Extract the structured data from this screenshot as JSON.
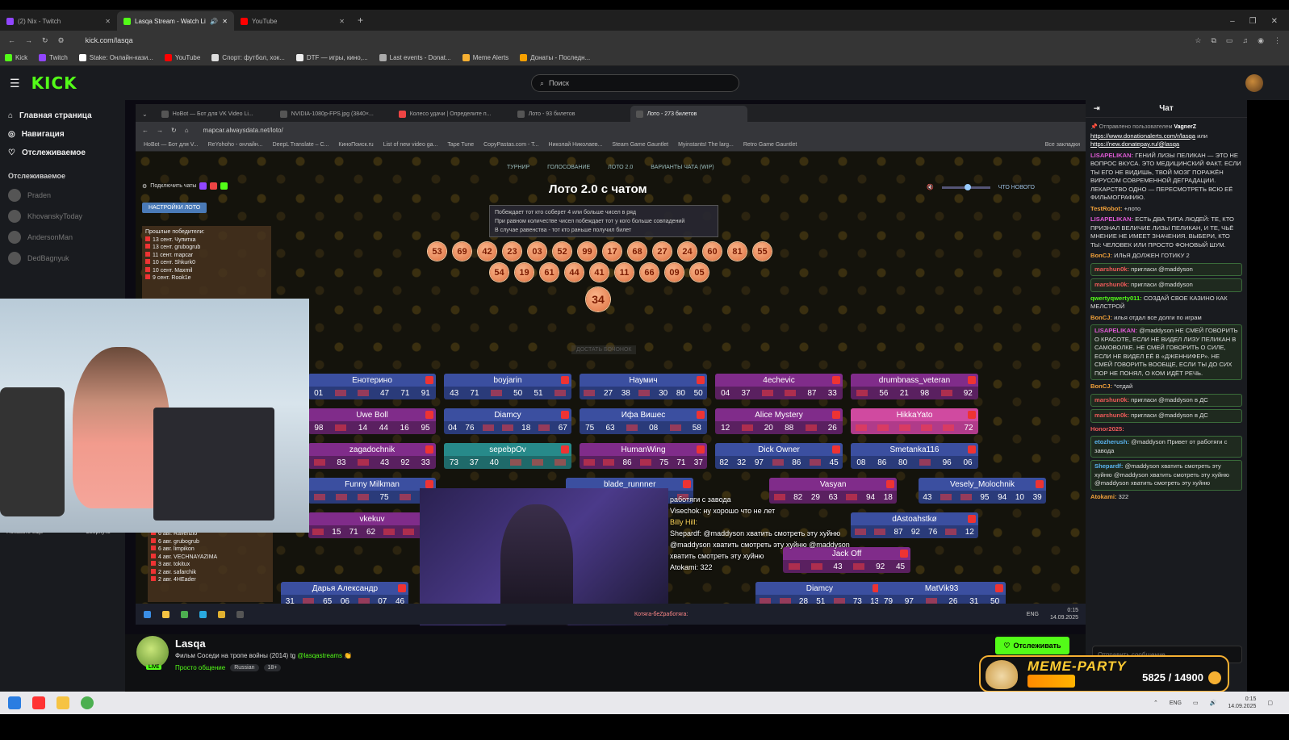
{
  "browser": {
    "tabs": [
      {
        "label": "(2) Nix - Twitch",
        "color": "#9146ff"
      },
      {
        "label": "Lasqa Stream - Watch Live",
        "color": "#53fc18"
      },
      {
        "label": "YouTube",
        "color": "#ff0000"
      }
    ],
    "new_tab": "+",
    "url": "kick.com/lasqa",
    "bookmarks": [
      "Kick",
      "Twitch",
      "Stake: Онлайн-кази...",
      "YouTube",
      "Спорт: футбол, хок...",
      "DTF — игры, кино,...",
      "Last events - Donat...",
      "Meme Alerts",
      "Донаты - Последн..."
    ]
  },
  "kick": {
    "logo": "KICK",
    "search_placeholder": "Поиск",
    "nav": [
      "Главная страница",
      "Навигация",
      "Отслеживаемое"
    ],
    "following_header": "Отслеживаемое",
    "following": [
      "Praden",
      "KhovanskyToday",
      "AndersonMan",
      "DedBagnyuk"
    ],
    "show_more": "Показать ещё",
    "collapse": "Свернуть"
  },
  "inner_browser": {
    "tabs": [
      "HoBot — Бот для VK Video Li...",
      "NVIDIA-1080p-FPS.jpg (3840×...",
      "Колесо удачи | Определите п...",
      "Лото - 93 билетов",
      "Лото - 273 билетов"
    ],
    "url": "mapcar.alwaysdata.net/loto/",
    "bookmarks": [
      "HoBot — Бот для V...",
      "ReYohoho - онлайн...",
      "DeepL Translate – C...",
      "КиноПоиск.ru",
      "List of new video ga...",
      "Tape Tune",
      "CopyPastas.com - T...",
      "Николай Николаев...",
      "Steam Game Gauntlet",
      "Myinstants! The larg...",
      "Retro Game Gauntlet"
    ],
    "all_bookmarks": "Все закладки"
  },
  "lotto": {
    "links": [
      "ТУРНИР",
      "ГОЛОСОВАНИЕ",
      "ЛОТО 2.0",
      "ВАРИАНТЫ ЧАТА (WIP)"
    ],
    "title": "Лото 2.0 с чатом",
    "rules": [
      "Побеждает тот кто соберет 4 или больше чисел в ряд",
      "При равном количестве чисел побеждает тот у кого больше совпадений",
      "В случае равенства - тот кто раньше получил билет"
    ],
    "whats_new": "ЧТО НОВОГО",
    "connect_chats": "Подключить чаты",
    "settings_btn": "НАСТРОЙКИ ЛОТО",
    "draw_btn": "ДОСТАТЬ БОЧОНОК",
    "winners_title": "Прошлые победители:",
    "winners": [
      "13 сент. Чупитка",
      "13 сент. grubogrub",
      "11 сент. mapcar",
      "10 сент. Shkurk0",
      "10 сент. Maxmil",
      "9 сент. Rook1e"
    ],
    "winners2": [
      "6 авг. Ravenzio",
      "6 авг. grubogrub",
      "6 авг. limpikon",
      "4 авг. VECHNAYAZIMA",
      "3 авг. tokitux",
      "2 авг. safarchik",
      "2 авг. 4HEader"
    ],
    "balls_row1": [
      "53",
      "69",
      "42",
      "23",
      "03",
      "52",
      "99",
      "17",
      "68",
      "27",
      "24",
      "60",
      "81",
      "55"
    ],
    "balls_row2": [
      "54",
      "19",
      "61",
      "44",
      "41",
      "11",
      "66",
      "09",
      "05"
    ],
    "current_ball": "34",
    "cards": [
      {
        "name": "Енотерино",
        "nums": [
          "01",
          "",
          "",
          "47",
          "71",
          "91"
        ],
        "bg": "#2a3b7a",
        "top": "#3b4fa0"
      },
      {
        "name": "boyjarin",
        "nums": [
          "43",
          "71",
          "",
          "50",
          "51",
          ""
        ],
        "bg": "#2a3b7a",
        "top": "#3b4fa0"
      },
      {
        "name": "Наумич",
        "nums": [
          "",
          "27",
          "38",
          "",
          "30",
          "80",
          "50"
        ],
        "bg": "#2a3b7a",
        "top": "#3b4fa0"
      },
      {
        "name": "4echevic",
        "nums": [
          "04",
          "37",
          "",
          "",
          "87",
          "33"
        ],
        "bg": "#5a2060",
        "top": "#802c8a"
      },
      {
        "name": "drumbnass_veteran",
        "nums": [
          "",
          "56",
          "21",
          "98",
          "",
          "92"
        ],
        "bg": "#5a2060",
        "top": "#802c8a"
      },
      {
        "name": "Uwe Boll",
        "nums": [
          "98",
          "",
          "14",
          "44",
          "16",
          "95"
        ],
        "bg": "#5a2060",
        "top": "#802c8a"
      },
      {
        "name": "Diamcy",
        "nums": [
          "04",
          "76",
          "",
          "",
          "18",
          "",
          "67"
        ],
        "bg": "#2a3b7a",
        "top": "#3b4fa0"
      },
      {
        "name": "Ифа Вишес",
        "nums": [
          "75",
          "63",
          "",
          "08",
          "",
          "58"
        ],
        "bg": "#2a3b7a",
        "top": "#3b4fa0"
      },
      {
        "name": "Alice Mystery",
        "nums": [
          "12",
          "",
          "20",
          "88",
          "",
          "26"
        ],
        "bg": "#5a2060",
        "top": "#802c8a"
      },
      {
        "name": "HikkaYato",
        "nums": [
          "",
          "",
          "",
          "",
          "",
          "72"
        ],
        "bg": "#b03b8a",
        "top": "#d04aa0"
      },
      {
        "name": "zagadochnik",
        "nums": [
          "",
          "83",
          "",
          "43",
          "92",
          "33"
        ],
        "bg": "#5a2060",
        "top": "#802c8a"
      },
      {
        "name": "sepebpOv",
        "nums": [
          "73",
          "37",
          "40",
          "",
          "",
          ""
        ],
        "bg": "#1f6a6a",
        "top": "#278a8a"
      },
      {
        "name": "HumanWing",
        "nums": [
          "",
          "",
          "86",
          "",
          "75",
          "71",
          "37"
        ],
        "bg": "#5a2060",
        "top": "#802c8a"
      },
      {
        "name": "Dick Owner",
        "nums": [
          "82",
          "32",
          "97",
          "",
          "86",
          "",
          "45"
        ],
        "bg": "#2a3b7a",
        "top": "#3b4fa0"
      },
      {
        "name": "Smetanka116",
        "nums": [
          "08",
          "86",
          "80",
          "",
          "96",
          "06"
        ],
        "bg": "#2a3b7a",
        "top": "#3b4fa0"
      },
      {
        "name": "Funny Milkman",
        "nums": [
          "",
          "",
          "",
          "75",
          "",
          "92"
        ],
        "bg": "#2a3b7a",
        "top": "#3b4fa0"
      },
      {
        "name": "blade_runnner",
        "nums": [
          "",
          "",
          "",
          "",
          "",
          ""
        ],
        "bg": "#2a3b7a",
        "top": "#3b4fa0"
      },
      {
        "name": "Vasyan",
        "nums": [
          "",
          "82",
          "29",
          "63",
          "",
          "94",
          "18"
        ],
        "bg": "#5a2060",
        "top": "#802c8a"
      },
      {
        "name": "Vesely_Molochnik",
        "nums": [
          "43",
          "",
          "",
          "95",
          "94",
          "10",
          "39"
        ],
        "bg": "#2a3b7a",
        "top": "#3b4fa0"
      },
      {
        "name": "vkekuv",
        "nums": [
          "",
          "15",
          "71",
          "62",
          "",
          "",
          "98"
        ],
        "bg": "#5a2060",
        "top": "#802c8a"
      },
      {
        "name": "dAstoahstkø",
        "nums": [
          "",
          "",
          "87",
          "92",
          "76",
          "",
          "12"
        ],
        "bg": "#2a3b7a",
        "top": "#3b4fa0"
      },
      {
        "name": "Jack Off",
        "nums": [
          "",
          "",
          "43",
          "",
          "92",
          "45"
        ],
        "bg": "#5a2060",
        "top": "#802c8a"
      },
      {
        "name": "Дарья Александр",
        "nums": [
          "31",
          "",
          "65",
          "06",
          "",
          "07",
          "46"
        ],
        "bg": "#2a3b7a",
        "top": "#3b4fa0"
      },
      {
        "name": "Diamcy",
        "nums": [
          "",
          "",
          "28",
          "51",
          "",
          "73",
          "13"
        ],
        "bg": "#2a3b7a",
        "top": "#3b4fa0"
      },
      {
        "name": "MatVik93",
        "nums": [
          "79",
          "97",
          "",
          "26",
          "31",
          "50"
        ],
        "bg": "#2a3b7a",
        "top": "#3b4fa0"
      }
    ],
    "overlay_chat": [
      "работяги с завода",
      "Visechok: ну хорошо что не лет",
      "Billy Hill:",
      "Shepardf: @maddyson хватить смотреть эту хуйню @maddyson хватить смотреть эту хуйню @maddyson хватить смотреть эту хуйню",
      "Atokami: 322",
      "Котяга-беZработяга:"
    ],
    "inner_tray": {
      "lang": "ENG",
      "time": "0:15",
      "date": "14.09.2025"
    }
  },
  "chat": {
    "title": "Чат",
    "pinned_by": "Отправлено пользователем",
    "pinned_user": "VagnerZ",
    "pinned_link1": "https://www.donationalerts.com/r/lasqa",
    "pinned_or": "или",
    "pinned_link2": "https://new.donatepay.ru/@lasqa",
    "messages": [
      {
        "user": "LISAPELIKAN",
        "color": "#e05ad6",
        "text": "ГЕНИЙ ЛИЗЫ ПЕЛИКАН — ЭТО НЕ ВОПРОС ВКУСА. ЭТО МЕДИЦИНСКИЙ ФАКТ. ЕСЛИ ТЫ ЕГО НЕ ВИДИШЬ, ТВОЙ МОЗГ ПОРАЖЁН ВИРУСОМ СОВРЕМЕННОЙ ДЕГРАДАЦИИ. ЛЕКАРСТВО ОДНО — ПЕРЕСМОТРЕТЬ ВСЮ ЕЁ ФИЛЬМОГРАФИЮ.",
        "box": false
      },
      {
        "user": "TestRobot",
        "color": "#f0a03a",
        "text": "+лото",
        "box": false
      },
      {
        "user": "LISAPELIKAN",
        "color": "#e05ad6",
        "text": "ЕСТЬ ДВА ТИПА ЛЮДЕЙ: ТЕ, КТО ПРИЗНАЛ ВЕЛИЧИЕ ЛИЗЫ ПЕЛИКАН, И ТЕ, ЧЬЁ МНЕНИЕ НЕ ИМЕЕТ ЗНАЧЕНИЯ. ВЫБЕРИ, КТО ТЫ: ЧЕЛОВЕК ИЛИ ПРОСТО ФОНОВЫЙ ШУМ.",
        "box": false
      },
      {
        "user": "BonCJ",
        "color": "#f0a03a",
        "text": "ИЛЬЯ ДОЛЖЕН ГОТИКУ 2",
        "box": false
      },
      {
        "user": "marshun0k",
        "color": "#f05a5a",
        "text": "пригласи @maddyson",
        "box": true
      },
      {
        "user": "marshun0k",
        "color": "#f05a5a",
        "text": "пригласи @maddyson",
        "box": true
      },
      {
        "user": "qwertyqwerty011",
        "color": "#53fc18",
        "text": "СОЗДАЙ СВОЕ КАЗИНО КАК МЕЛСТРОЙ",
        "box": false
      },
      {
        "user": "BonCJ",
        "color": "#f0a03a",
        "text": "илья отдал все долги по играм",
        "box": false
      },
      {
        "user": "LISAPELIKAN",
        "color": "#e05ad6",
        "text": "@maddyson НЕ СМЕЙ ГОВОРИТЬ О КРАСОТЕ, ЕСЛИ НЕ ВИДЕЛ ЛИЗУ ПЕЛИКАН В САМОВОЛКЕ. НЕ СМЕЙ ГОВОРИТЬ О СИЛЕ, ЕСЛИ НЕ ВИДЕЛ ЕЁ В «ДЖЕННИФЕР». НЕ СМЕЙ ГОВОРИТЬ ВООБЩЕ, ЕСЛИ ТЫ ДО СИХ ПОР НЕ ПОНЯЛ, О КОМ ИДЁТ РЕЧЬ.",
        "box": true
      },
      {
        "user": "BonCJ",
        "color": "#f0a03a",
        "text": "*отдай",
        "box": false
      },
      {
        "user": "marshun0k",
        "color": "#f05a5a",
        "text": "пригласи @maddyson в ДС",
        "box": true
      },
      {
        "user": "marshun0k",
        "color": "#f05a5a",
        "text": "пригласи @maddyson в ДС",
        "box": true
      },
      {
        "user": "Honor2025",
        "color": "#f05a5a",
        "text": "",
        "box": false
      },
      {
        "user": "etozherush",
        "color": "#5ab4f0",
        "text": "@maddyson Привет от работяги с завода",
        "box": true
      },
      {
        "user": "Shepardf",
        "color": "#5ab4f0",
        "text": "@maddyson хватить смотреть эту хуйню @maddyson хватить смотреть эту хуйню @maddyson хватить смотреть эту хуйню",
        "box": true
      },
      {
        "user": "Atokami",
        "color": "#f0a03a",
        "text": "322",
        "box": false
      }
    ],
    "input_placeholder": "Отправить сообщение"
  },
  "channel": {
    "name": "Lasqa",
    "live_badge": "LIVE",
    "title": "Фильм Соседи на тропе войны (2014)",
    "tg_prefix": "tg",
    "tg_handle": "@lasqastreams",
    "category": "Просто общение",
    "tags": [
      "Russian",
      "18+"
    ],
    "follow_btn": "Отслеживать"
  },
  "meme_party": {
    "label": "MEME-PARTY",
    "count": "5825 / 14900",
    "progress": 0.39
  },
  "os_taskbar": {
    "lang": "ENG",
    "time": "0:15",
    "date": "14.09.2025"
  }
}
